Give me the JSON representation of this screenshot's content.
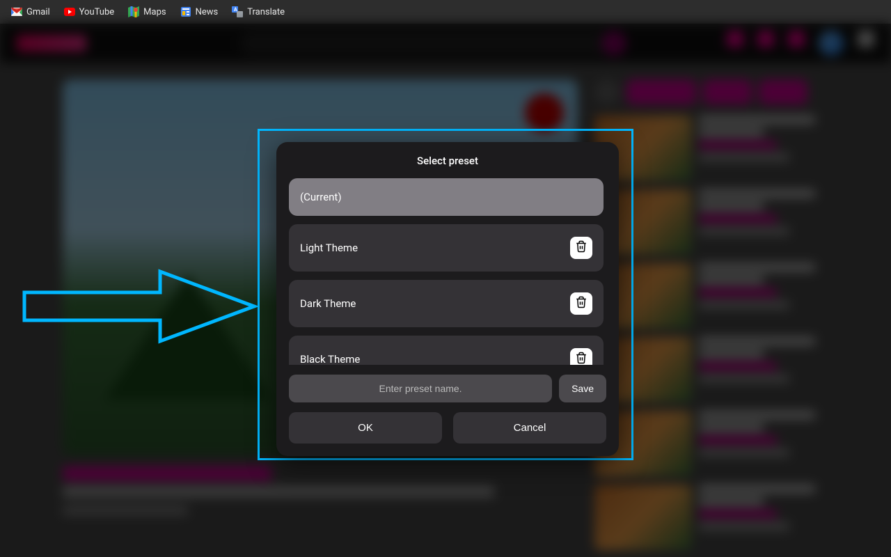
{
  "bookmarks": [
    {
      "id": "gmail",
      "label": "Gmail"
    },
    {
      "id": "youtube",
      "label": "YouTube"
    },
    {
      "id": "maps",
      "label": "Maps"
    },
    {
      "id": "news",
      "label": "News"
    },
    {
      "id": "translate",
      "label": "Translate"
    }
  ],
  "dialog": {
    "title": "Select preset",
    "presets": [
      {
        "label": "(Current)",
        "selected": true,
        "deletable": false
      },
      {
        "label": "Light Theme",
        "selected": false,
        "deletable": true
      },
      {
        "label": "Dark Theme",
        "selected": false,
        "deletable": true
      },
      {
        "label": "Black Theme",
        "selected": false,
        "deletable": true
      }
    ],
    "input_placeholder": "Enter preset name.",
    "save_label": "Save",
    "ok_label": "OK",
    "cancel_label": "Cancel"
  }
}
